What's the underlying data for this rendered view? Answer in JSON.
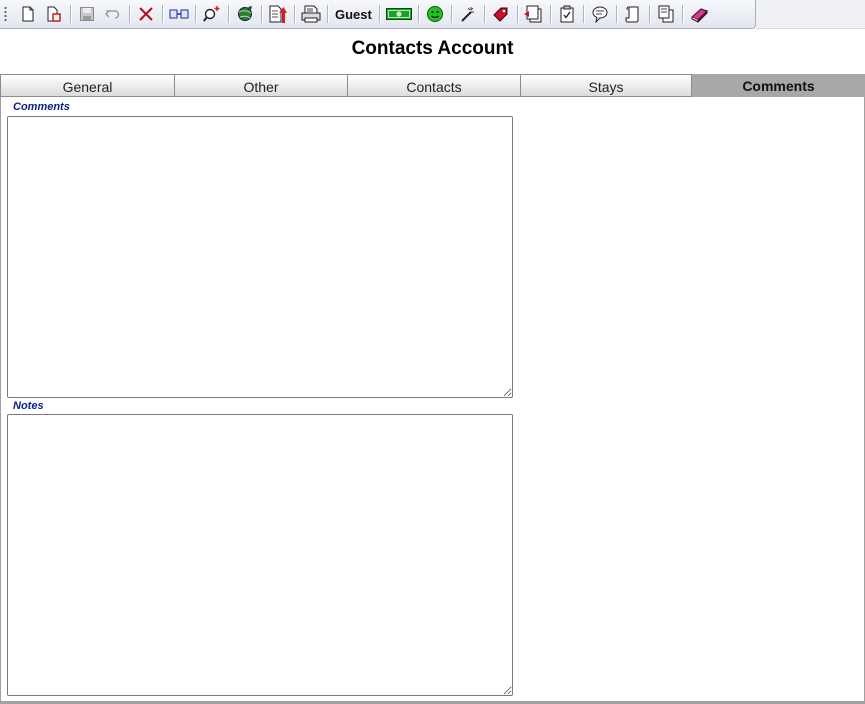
{
  "toolbar": {
    "guest_label": "Guest",
    "icons": [
      "new-document-icon",
      "delete-document-icon",
      "save-icon",
      "undo-icon",
      "delete-x-icon",
      "link-icon",
      "search-icon",
      "globe-icon",
      "export-icon",
      "print-icon",
      "money-icon",
      "smiley-icon",
      "magic-wand-icon",
      "tag-icon",
      "copy-stack-icon",
      "checklist-icon",
      "speech-bubble-icon",
      "scroll-icon",
      "documents-icon",
      "book-icon"
    ]
  },
  "page": {
    "title": "Contacts Account"
  },
  "tabs": [
    {
      "label": "General",
      "active": false
    },
    {
      "label": "Other",
      "active": false
    },
    {
      "label": "Contacts",
      "active": false
    },
    {
      "label": "Stays",
      "active": false
    },
    {
      "label": "Comments",
      "active": true
    }
  ],
  "fields": {
    "comments": {
      "label": "Comments",
      "value": ""
    },
    "notes": {
      "label": "Notes",
      "value": ""
    }
  },
  "colors": {
    "label_blue": "#0b1e8a",
    "active_tab": "#a9a7a8",
    "money_green": "#1e9e2c",
    "smiley_green": "#22c322",
    "export_red": "#d0202a"
  }
}
